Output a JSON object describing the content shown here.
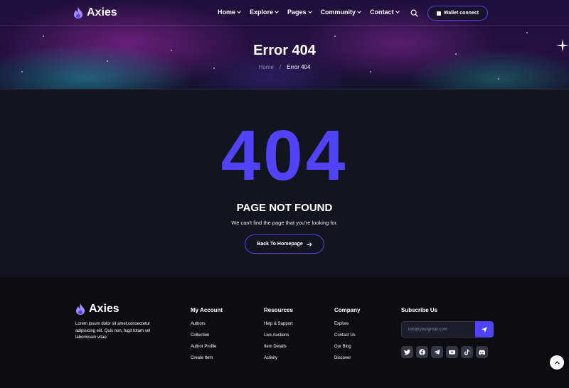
{
  "header": {
    "brand": "Axies",
    "nav": [
      {
        "label": "Home"
      },
      {
        "label": "Explore"
      },
      {
        "label": "Pages"
      },
      {
        "label": "Community"
      },
      {
        "label": "Contact"
      }
    ],
    "wallet_label": "Wallet connect"
  },
  "hero": {
    "title": "Error 404",
    "breadcrumb_home": "Home",
    "breadcrumb_sep": "/",
    "breadcrumb_current": "Error 404"
  },
  "error": {
    "code": "404",
    "heading": "PAGE NOT FOUND",
    "message": "We can't find the page that you're looking for.",
    "button_label": "Back To Homepage"
  },
  "footer": {
    "brand": "Axies",
    "description": "Lorem ipsum dolor sit amet,consectetur adipisicing elit. Quis non, fugit totam vel laboriosam vitae.",
    "columns": [
      {
        "title": "My Account",
        "links": [
          "Authors",
          "Collection",
          "Author Profile",
          "Create Item"
        ]
      },
      {
        "title": "Resources",
        "links": [
          "Help & Support",
          "Live Auctions",
          "Item Details",
          "Activity"
        ]
      },
      {
        "title": "Company",
        "links": [
          "Explore",
          "Contact Us",
          "Our Blog",
          "Discover"
        ]
      }
    ],
    "subscribe_title": "Subscribe Us",
    "subscribe_placeholder": "info@yourgmail.com",
    "socials": [
      "twitter-icon",
      "facebook-icon",
      "telegram-icon",
      "youtube-icon",
      "tiktok-icon",
      "discord-icon"
    ]
  },
  "colors": {
    "accent": "#5142fc",
    "background": "#14141f",
    "footer_bg": "#0d0d11",
    "muted_text": "#8a8aa0"
  }
}
